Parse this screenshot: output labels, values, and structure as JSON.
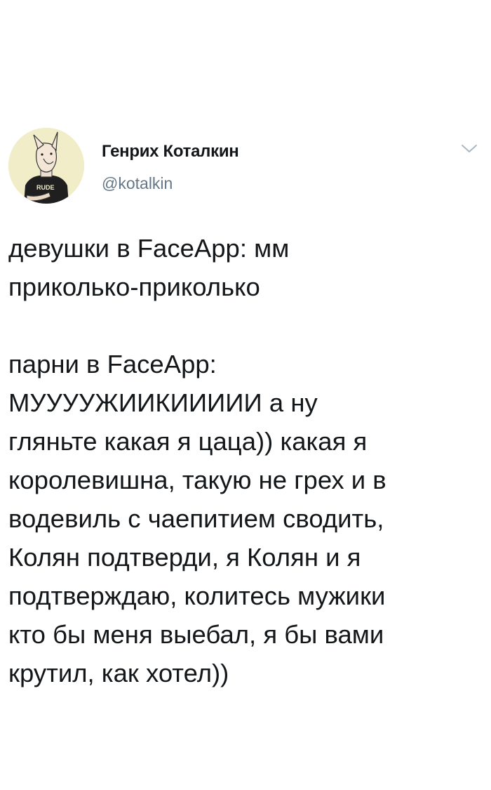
{
  "tweet": {
    "author": {
      "display_name": "Генрих Коталкин",
      "handle": "@kotalkin",
      "avatar_icon": "dog-avatar-icon",
      "avatar_shirt_text": "RUDE"
    },
    "menu_icon": "chevron-down-icon",
    "text": {
      "line1": "девушки в FaceApp: мм",
      "line2": "приколько-приколько",
      "line3": "парни в FaceApp:",
      "line4": "МУУУУЖИИКИИИИИ а ну",
      "line5": "гляньте какая я цаца)) какая я",
      "line6": "королевишна, такую не грех и в",
      "line7": "водевиль с чаепитием сводить,",
      "line8": "Колян подтверди, я Колян и я",
      "line9": "подтверждаю, колитесь мужики",
      "line10": "кто бы меня выебал, я бы вами",
      "line11": "крутил, как хотел))"
    }
  },
  "colors": {
    "text": "#14171a",
    "secondary": "#657786",
    "background": "#ffffff",
    "avatar_bg": "#f1edc9"
  }
}
